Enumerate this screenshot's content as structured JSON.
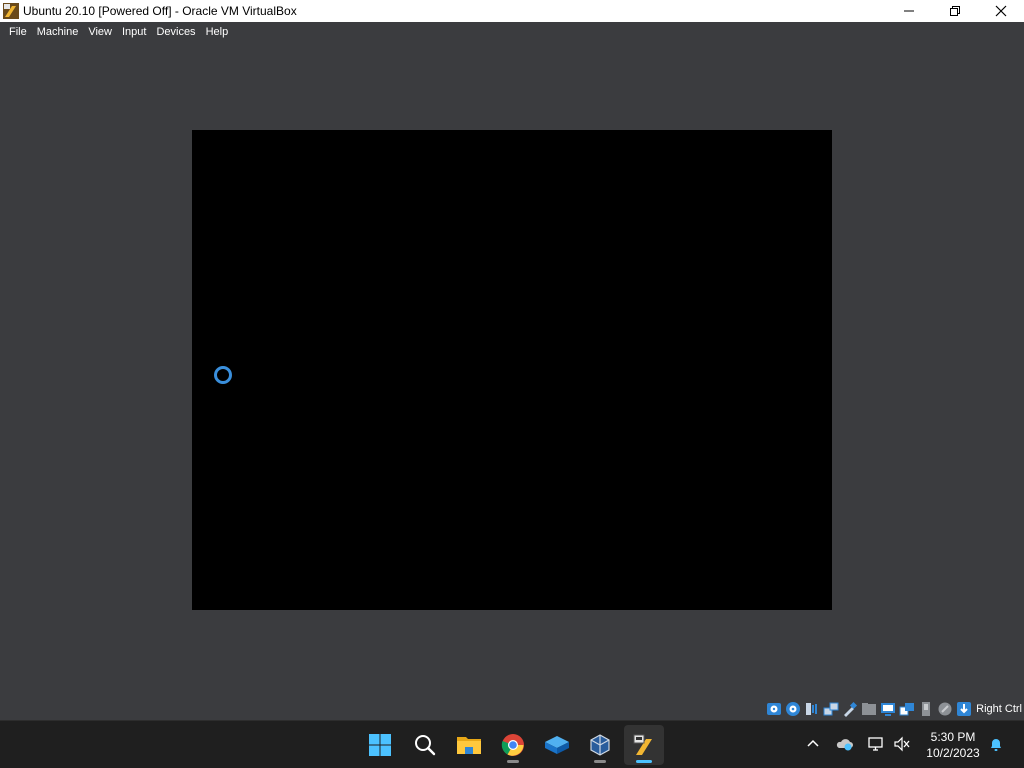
{
  "window": {
    "title": "Ubuntu 20.10 [Powered Off] - Oracle VM VirtualBox",
    "icon": "virtualbox-vm-icon",
    "controls": [
      "minimize-icon",
      "maximize-icon",
      "close-icon"
    ]
  },
  "menu": {
    "items": [
      "File",
      "Machine",
      "View",
      "Input",
      "Devices",
      "Help"
    ]
  },
  "vm_display": {
    "state": "booting",
    "spinner_color": "#3a8fdc",
    "background": "#000000"
  },
  "statusbar": {
    "icons": [
      "hard-disk-icon",
      "optical-drive-icon",
      "audio-icon",
      "network-icon",
      "usb-icon",
      "shared-folders-icon",
      "display-icon",
      "recording-icon",
      "cpu-icon",
      "mouse-integration-icon",
      "keyboard-capture-icon"
    ],
    "host_key": "Right Ctrl"
  },
  "taskbar": {
    "apps": [
      {
        "name": "start",
        "icon": "windows-start-icon"
      },
      {
        "name": "search",
        "icon": "search-icon"
      },
      {
        "name": "file-explorer",
        "icon": "folder-icon"
      },
      {
        "name": "chrome",
        "icon": "chrome-icon",
        "running": true
      },
      {
        "name": "virtualbox-manager-alt",
        "icon": "azure-cube-icon"
      },
      {
        "name": "virtualbox",
        "icon": "virtualbox-icon",
        "running": true
      },
      {
        "name": "vm-window",
        "icon": "virtualbox-vm-icon",
        "active": true
      }
    ],
    "tray": {
      "icons": [
        "chevron-up-icon",
        "onedrive-icon",
        "network-monitor-icon",
        "volume-muted-icon"
      ],
      "time": "5:30 PM",
      "date": "10/2/2023",
      "notification_icon": "bell-icon"
    }
  },
  "colors": {
    "accent": "#4cc2ff",
    "window_bg": "#3b3c3f",
    "taskbar_bg": "#1f1f1f"
  }
}
